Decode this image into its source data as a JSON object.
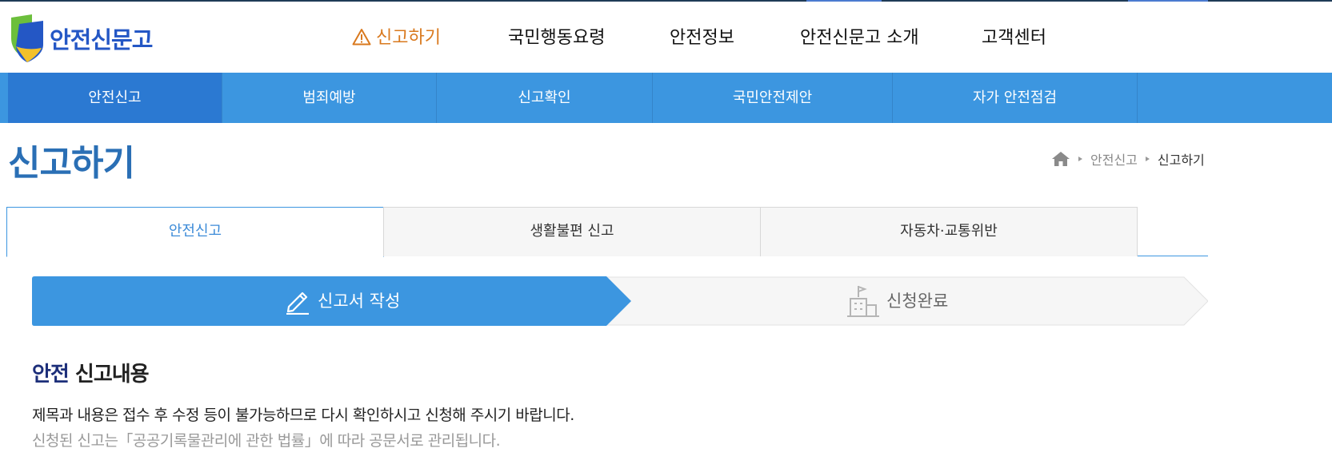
{
  "brand": {
    "name": "안전신문고",
    "colors": {
      "primary": "#3c96e0",
      "active": "#2b79d2",
      "accent": "#d9791e",
      "logo_blue": "#2457c5",
      "logo_yellow": "#f3c12a",
      "logo_green": "#6cbf3c"
    }
  },
  "gnb": {
    "items": [
      {
        "label": "신고하기",
        "icon": "warning-icon"
      },
      {
        "label": "국민행동요령"
      },
      {
        "label": "안전정보"
      },
      {
        "label": "안전신문고 소개"
      },
      {
        "label": "고객센터"
      }
    ]
  },
  "subnav": {
    "items": [
      "안전신고",
      "범죄예방",
      "신고확인",
      "국민안전제안",
      "자가 안전점검"
    ]
  },
  "page": {
    "title": "신고하기",
    "breadcrumb": {
      "home_icon": "home-icon",
      "items": [
        "안전신고",
        "신고하기"
      ]
    }
  },
  "tabs": [
    "안전신고",
    "생활불편 신고",
    "자동차·교통위반"
  ],
  "steps": [
    {
      "label": "신고서 작성",
      "icon": "pencil-icon"
    },
    {
      "label": "신청완료",
      "icon": "building-flag-icon"
    }
  ],
  "content": {
    "section_title_accent": "안전",
    "section_title_rest": " 신고내용",
    "notice_main": "제목과 내용은 접수 후 수정 등이 불가능하므로 다시 확인하시고 신청해 주시기 바랍니다.",
    "notice_sub": "신청된 신고는「공공기록물관리에 관한 법률」에 따라 공문서로 관리됩니다."
  }
}
